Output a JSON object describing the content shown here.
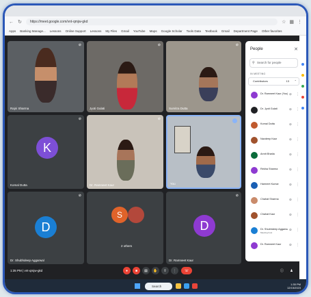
{
  "browser": {
    "url": "https://meet.google.com/vnt-qmjw-gkd",
    "bookmarks": [
      "Apps",
      "Banking Manage...",
      "Lessons",
      "Online Support",
      "Lessons",
      "My Files",
      "Gmail",
      "YouTube",
      "Maps",
      "Google Scholar",
      "Tools Data",
      "Textbook",
      "Gmail",
      "Department Page",
      "Other favorites"
    ]
  },
  "meeting": {
    "code": "vnt-qmjw-gkd",
    "time": "1:35 PM",
    "tiles": [
      {
        "name": "Rajni Sharma",
        "type": "video"
      },
      {
        "name": "Jyoti Gulati",
        "type": "video"
      },
      {
        "name": "Sumitra Dutta",
        "type": "video"
      },
      {
        "name": "Komal Dutta",
        "type": "avatar",
        "initial": "K",
        "color": "#7d4fd6"
      },
      {
        "name": "Dr. Ramneet Kaur",
        "type": "video"
      },
      {
        "name": "You",
        "type": "video"
      },
      {
        "name": "Dr. Shubhdeep Aggarwal",
        "type": "avatar",
        "initial": "D",
        "color": "#1a7fd4"
      },
      {
        "name": "2 others",
        "type": "group",
        "initial": "S",
        "color": "#e0632a"
      },
      {
        "name": "Dr. Ramneet Kaur",
        "type": "avatar",
        "initial": "D",
        "color": "#8e3ad1"
      }
    ]
  },
  "people_panel": {
    "title": "People",
    "search_placeholder": "Search for people",
    "section": "IN MEETING",
    "group_label": "Contributors",
    "group_count": "13",
    "participants": [
      {
        "name": "Dr. Ramneet Kaur (You)",
        "color": "#8e3ad1",
        "sub": ""
      },
      {
        "name": "Dr. Jyoti Gulati",
        "color": "#202124",
        "sub": ""
      },
      {
        "name": "Komal Dutta",
        "color": "#c05a2e",
        "sub": ""
      },
      {
        "name": "Navdeep Kaur",
        "color": "#a0522d",
        "sub": ""
      },
      {
        "name": "Amrit Bhatia",
        "color": "#0b6b3a",
        "sub": ""
      },
      {
        "name": "Rekha Sharma",
        "color": "#8e3ad1",
        "sub": ""
      },
      {
        "name": "Harmeet Kumar",
        "color": "#1a5fb4",
        "sub": ""
      },
      {
        "name": "Chahat Sharma",
        "color": "#c98b6b",
        "sub": ""
      },
      {
        "name": "Chahat Kaur",
        "color": "#a0522d",
        "sub": ""
      },
      {
        "name": "Dr. Shubhdeep Aggarwal",
        "color": "#1a7fd4",
        "sub": "Meeting host"
      },
      {
        "name": "Dr. Ramneet Kaur",
        "color": "#8e3ad1",
        "sub": ""
      }
    ]
  },
  "taskbar": {
    "search": "Search",
    "time": "1:35 PM",
    "date": "12/15/2023"
  }
}
